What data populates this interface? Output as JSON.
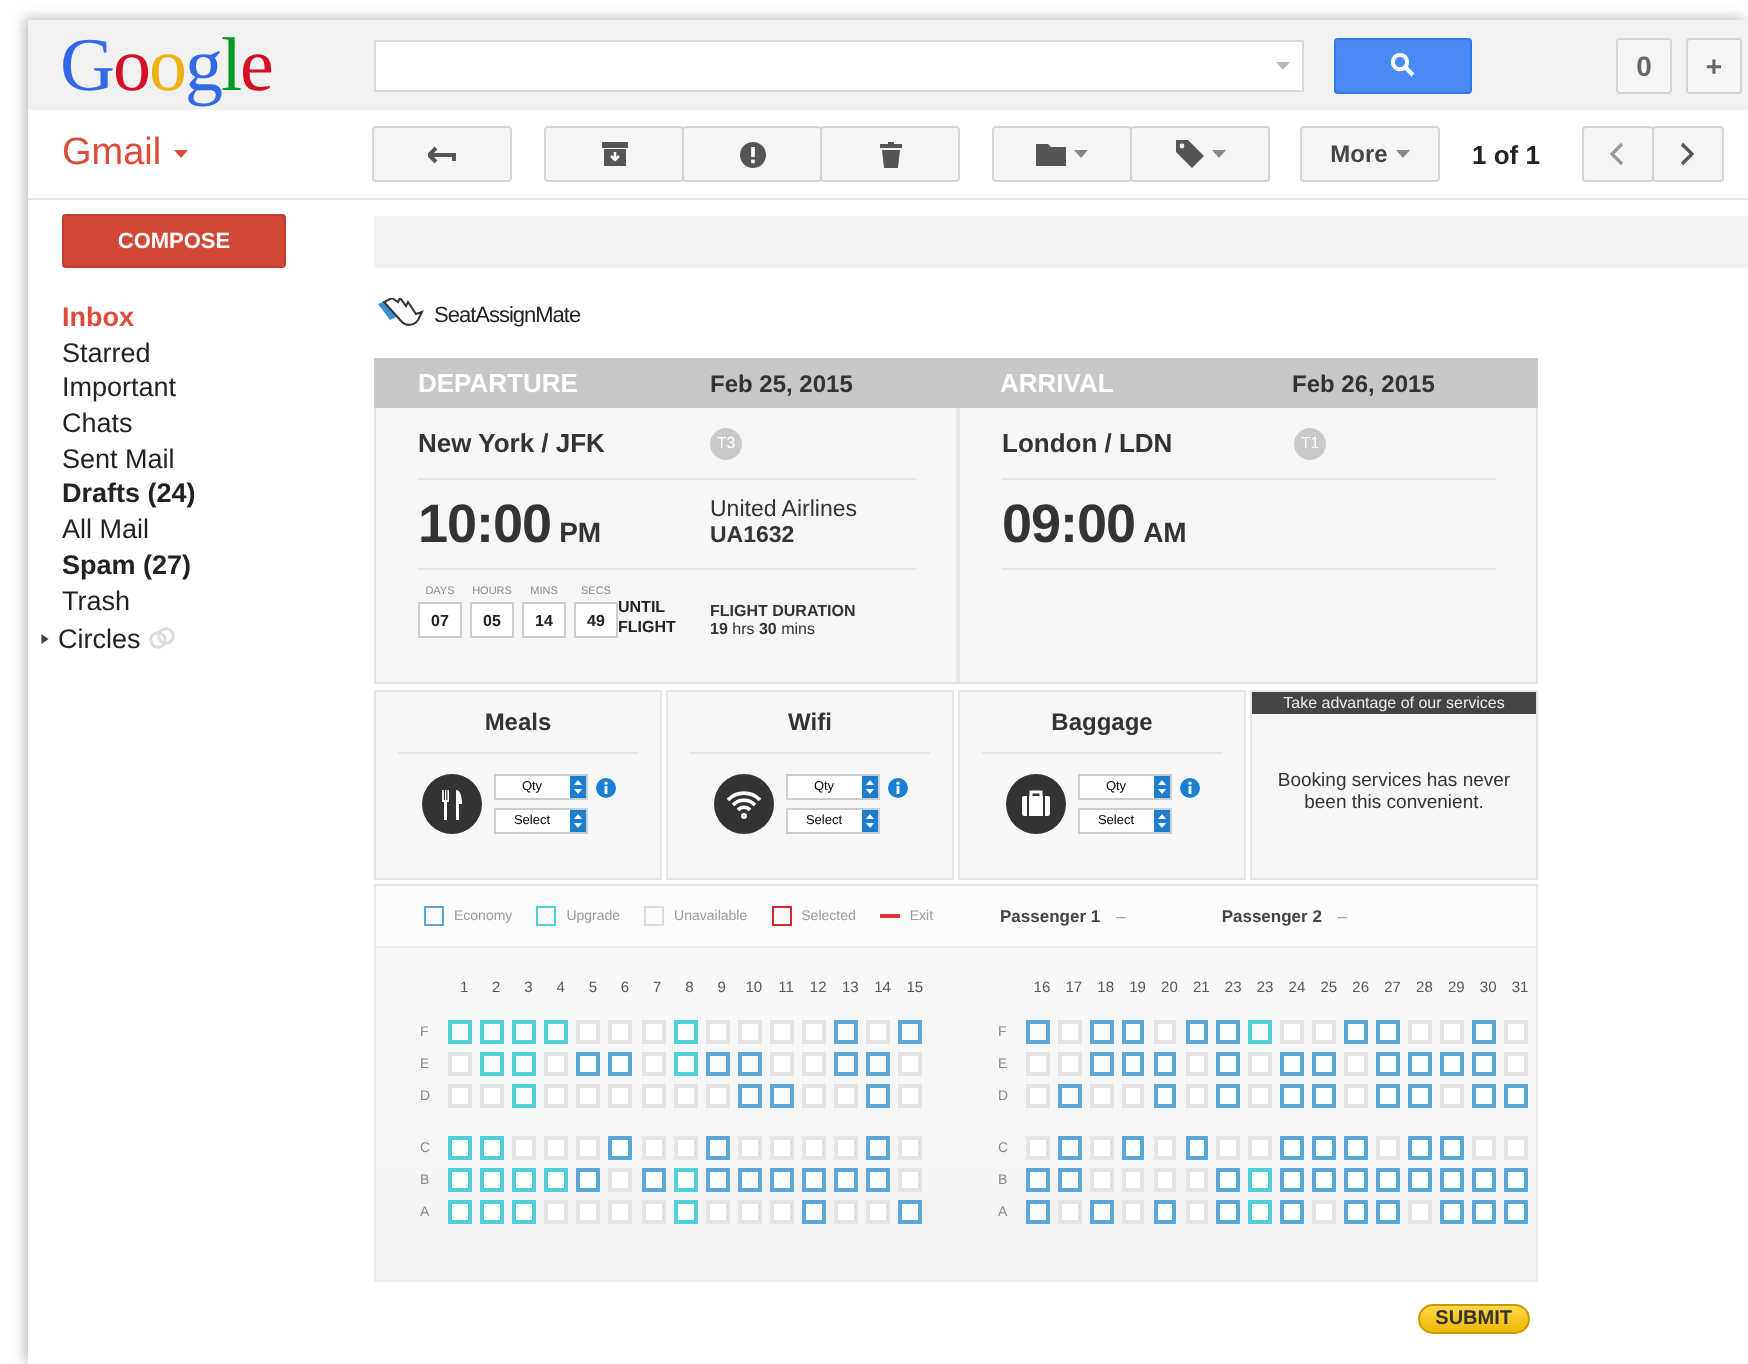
{
  "header": {
    "logo": "Google",
    "counter_button": "0",
    "add_button": "+"
  },
  "toolbar": {
    "app_label": "Gmail",
    "more": "More",
    "pagination": "1 of 1"
  },
  "sidebar": {
    "compose": "COMPOSE",
    "items": [
      {
        "label": "Inbox",
        "selected": true,
        "bold": true
      },
      {
        "label": "Starred",
        "selected": false,
        "bold": false
      },
      {
        "label": "Important",
        "selected": false,
        "bold": false
      },
      {
        "label": "Chats",
        "selected": false,
        "bold": false
      },
      {
        "label": "Sent Mail",
        "selected": false,
        "bold": false
      },
      {
        "label": "Drafts (24)",
        "selected": false,
        "bold": true
      },
      {
        "label": "All Mail",
        "selected": false,
        "bold": false
      },
      {
        "label": "Spam (27)",
        "selected": false,
        "bold": true
      },
      {
        "label": "Trash",
        "selected": false,
        "bold": false
      }
    ],
    "circles": {
      "label": "Circles",
      "expanded": false
    }
  },
  "email": {
    "brand": "SeatAssignMate",
    "flight": {
      "departure": {
        "heading": "DEPARTURE",
        "date": "Feb 25, 2015",
        "city": "New York / JFK",
        "terminal": "T3",
        "time": "10:00",
        "meridiem": "PM",
        "airline": "United Airlines",
        "flight_number": "UA1632",
        "countdown": [
          {
            "unit": "DAYS",
            "value": "07"
          },
          {
            "unit": "HOURS",
            "value": "05"
          },
          {
            "unit": "MINS",
            "value": "14"
          },
          {
            "unit": "SECS",
            "value": "49"
          }
        ],
        "countdown_label": "UNTIL FLIGHT",
        "duration_label": "FLIGHT DURATION",
        "duration": "**19** hrs  **30** mins"
      },
      "arrival": {
        "heading": "ARRIVAL",
        "date": "Feb 26, 2015",
        "city": "London / LDN",
        "terminal": "T1",
        "time": "09:00",
        "meridiem": "AM"
      }
    },
    "services": [
      {
        "kind": "meals",
        "title": "Meals",
        "qty": "Qty",
        "select": "Select"
      },
      {
        "kind": "wifi",
        "title": "Wifi",
        "qty": "Qty",
        "select": "Select"
      },
      {
        "kind": "baggage",
        "title": "Baggage",
        "qty": "Qty",
        "select": "Select"
      }
    ],
    "promo": {
      "heading": "Take advantage of our services",
      "text": "Booking services has never been this convenient."
    },
    "legend": [
      {
        "kind": "economy",
        "label": "Economy"
      },
      {
        "kind": "upgrade",
        "label": "Upgrade"
      },
      {
        "kind": "unavailable",
        "label": "Unavailable"
      },
      {
        "kind": "selected",
        "label": "Selected"
      },
      {
        "kind": "exit",
        "label": "Exit"
      }
    ],
    "passengers": [
      {
        "label": "Passenger 1",
        "seat": "–"
      },
      {
        "label": "Passenger 2",
        "seat": "–"
      }
    ],
    "seat_map": {
      "sections": [
        {
          "columns": [
            "1",
            "2",
            "3",
            "4",
            "5",
            "6",
            "7",
            "8",
            "9",
            "10",
            "11",
            "12",
            "13",
            "14",
            "15"
          ],
          "rows": [
            {
              "letter": "F",
              "seats": [
                {
                  "kind": "upgrade"
                },
                {
                  "kind": "upgrade"
                },
                {
                  "kind": "upgrade"
                },
                {
                  "kind": "upgrade"
                },
                {
                  "kind": "unavailable"
                },
                {
                  "kind": "unavailable"
                },
                {
                  "kind": "unavailable"
                },
                {
                  "kind": "upgrade"
                },
                {
                  "kind": "unavailable"
                },
                {
                  "kind": "unavailable"
                },
                {
                  "kind": "unavailable"
                },
                {
                  "kind": "unavailable"
                },
                {
                  "kind": "economy"
                },
                {
                  "kind": "unavailable"
                },
                {
                  "kind": "economy"
                }
              ]
            },
            {
              "letter": "E",
              "seats": [
                {
                  "kind": "unavailable"
                },
                {
                  "kind": "upgrade"
                },
                {
                  "kind": "upgrade"
                },
                {
                  "kind": "unavailable"
                },
                {
                  "kind": "economy"
                },
                {
                  "kind": "economy"
                },
                {
                  "kind": "unavailable"
                },
                {
                  "kind": "upgrade"
                },
                {
                  "kind": "economy"
                },
                {
                  "kind": "economy"
                },
                {
                  "kind": "unavailable"
                },
                {
                  "kind": "unavailable"
                },
                {
                  "kind": "economy"
                },
                {
                  "kind": "economy"
                },
                {
                  "kind": "unavailable"
                }
              ]
            },
            {
              "letter": "D",
              "seats": [
                {
                  "kind": "unavailable"
                },
                {
                  "kind": "unavailable"
                },
                {
                  "kind": "upgrade"
                },
                {
                  "kind": "unavailable"
                },
                {
                  "kind": "unavailable"
                },
                {
                  "kind": "unavailable"
                },
                {
                  "kind": "unavailable"
                },
                {
                  "kind": "unavailable"
                },
                {
                  "kind": "unavailable"
                },
                {
                  "kind": "economy"
                },
                {
                  "kind": "economy"
                },
                {
                  "kind": "unavailable"
                },
                {
                  "kind": "unavailable"
                },
                {
                  "kind": "economy"
                },
                {
                  "kind": "unavailable"
                }
              ]
            },
            {
              "letter": "C",
              "seats": [
                {
                  "kind": "upgrade"
                },
                {
                  "kind": "upgrade"
                },
                {
                  "kind": "unavailable"
                },
                {
                  "kind": "unavailable"
                },
                {
                  "kind": "unavailable"
                },
                {
                  "kind": "economy"
                },
                {
                  "kind": "unavailable"
                },
                {
                  "kind": "unavailable"
                },
                {
                  "kind": "economy"
                },
                {
                  "kind": "unavailable"
                },
                {
                  "kind": "unavailable"
                },
                {
                  "kind": "unavailable"
                },
                {
                  "kind": "unavailable"
                },
                {
                  "kind": "economy"
                },
                {
                  "kind": "unavailable"
                }
              ]
            },
            {
              "letter": "B",
              "seats": [
                {
                  "kind": "upgrade"
                },
                {
                  "kind": "upgrade"
                },
                {
                  "kind": "upgrade"
                },
                {
                  "kind": "upgrade"
                },
                {
                  "kind": "economy"
                },
                {
                  "kind": "unavailable"
                },
                {
                  "kind": "economy"
                },
                {
                  "kind": "upgrade"
                },
                {
                  "kind": "economy"
                },
                {
                  "kind": "economy"
                },
                {
                  "kind": "economy"
                },
                {
                  "kind": "economy"
                },
                {
                  "kind": "economy"
                },
                {
                  "kind": "economy"
                },
                {
                  "kind": "unavailable"
                }
              ]
            },
            {
              "letter": "A",
              "seats": [
                {
                  "kind": "upgrade"
                },
                {
                  "kind": "upgrade"
                },
                {
                  "kind": "upgrade"
                },
                {
                  "kind": "unavailable"
                },
                {
                  "kind": "unavailable"
                },
                {
                  "kind": "unavailable"
                },
                {
                  "kind": "unavailable"
                },
                {
                  "kind": "upgrade"
                },
                {
                  "kind": "unavailable"
                },
                {
                  "kind": "unavailable"
                },
                {
                  "kind": "unavailable"
                },
                {
                  "kind": "economy"
                },
                {
                  "kind": "unavailable"
                },
                {
                  "kind": "unavailable"
                },
                {
                  "kind": "economy"
                }
              ]
            }
          ]
        },
        {
          "columns": [
            "16",
            "17",
            "18",
            "19",
            "20",
            "21",
            "23",
            "23",
            "24",
            "25",
            "26",
            "27",
            "28",
            "29",
            "30",
            "31"
          ],
          "rows": [
            {
              "letter": "F",
              "seats": [
                {
                  "kind": "economy"
                },
                {
                  "kind": "unavailable"
                },
                {
                  "kind": "economy"
                },
                {
                  "kind": "economy"
                },
                {
                  "kind": "unavailable"
                },
                {
                  "kind": "economy"
                },
                {
                  "kind": "economy"
                },
                {
                  "kind": "upgrade"
                },
                {
                  "kind": "unavailable"
                },
                {
                  "kind": "unavailable"
                },
                {
                  "kind": "economy"
                },
                {
                  "kind": "economy"
                },
                {
                  "kind": "unavailable"
                },
                {
                  "kind": "unavailable"
                },
                {
                  "kind": "economy"
                },
                {
                  "kind": "unavailable"
                }
              ]
            },
            {
              "letter": "E",
              "seats": [
                {
                  "kind": "unavailable"
                },
                {
                  "kind": "unavailable"
                },
                {
                  "kind": "economy"
                },
                {
                  "kind": "economy"
                },
                {
                  "kind": "economy"
                },
                {
                  "kind": "unavailable"
                },
                {
                  "kind": "economy"
                },
                {
                  "kind": "unavailable"
                },
                {
                  "kind": "economy"
                },
                {
                  "kind": "economy"
                },
                {
                  "kind": "unavailable"
                },
                {
                  "kind": "economy"
                },
                {
                  "kind": "economy"
                },
                {
                  "kind": "economy"
                },
                {
                  "kind": "economy"
                },
                {
                  "kind": "unavailable"
                }
              ]
            },
            {
              "letter": "D",
              "seats": [
                {
                  "kind": "unavailable"
                },
                {
                  "kind": "economy"
                },
                {
                  "kind": "unavailable"
                },
                {
                  "kind": "unavailable"
                },
                {
                  "kind": "economy"
                },
                {
                  "kind": "unavailable"
                },
                {
                  "kind": "economy"
                },
                {
                  "kind": "unavailable"
                },
                {
                  "kind": "economy"
                },
                {
                  "kind": "economy"
                },
                {
                  "kind": "unavailable"
                },
                {
                  "kind": "economy"
                },
                {
                  "kind": "economy"
                },
                {
                  "kind": "unavailable"
                },
                {
                  "kind": "economy"
                },
                {
                  "kind": "economy"
                }
              ]
            },
            {
              "letter": "C",
              "seats": [
                {
                  "kind": "unavailable"
                },
                {
                  "kind": "economy"
                },
                {
                  "kind": "unavailable"
                },
                {
                  "kind": "economy"
                },
                {
                  "kind": "unavailable"
                },
                {
                  "kind": "economy"
                },
                {
                  "kind": "unavailable"
                },
                {
                  "kind": "unavailable"
                },
                {
                  "kind": "economy"
                },
                {
                  "kind": "economy"
                },
                {
                  "kind": "economy"
                },
                {
                  "kind": "unavailable"
                },
                {
                  "kind": "economy"
                },
                {
                  "kind": "economy"
                },
                {
                  "kind": "unavailable"
                },
                {
                  "kind": "unavailable"
                }
              ]
            },
            {
              "letter": "B",
              "seats": [
                {
                  "kind": "economy"
                },
                {
                  "kind": "economy"
                },
                {
                  "kind": "unavailable"
                },
                {
                  "kind": "unavailable"
                },
                {
                  "kind": "unavailable"
                },
                {
                  "kind": "unavailable"
                },
                {
                  "kind": "economy"
                },
                {
                  "kind": "upgrade"
                },
                {
                  "kind": "economy"
                },
                {
                  "kind": "economy"
                },
                {
                  "kind": "economy"
                },
                {
                  "kind": "economy"
                },
                {
                  "kind": "economy"
                },
                {
                  "kind": "economy"
                },
                {
                  "kind": "economy"
                },
                {
                  "kind": "economy"
                }
              ]
            },
            {
              "letter": "A",
              "seats": [
                {
                  "kind": "economy"
                },
                {
                  "kind": "unavailable"
                },
                {
                  "kind": "economy"
                },
                {
                  "kind": "unavailable"
                },
                {
                  "kind": "economy"
                },
                {
                  "kind": "unavailable"
                },
                {
                  "kind": "economy"
                },
                {
                  "kind": "upgrade"
                },
                {
                  "kind": "economy"
                },
                {
                  "kind": "unavailable"
                },
                {
                  "kind": "economy"
                },
                {
                  "kind": "economy"
                },
                {
                  "kind": "unavailable"
                },
                {
                  "kind": "economy"
                },
                {
                  "kind": "economy"
                },
                {
                  "kind": "economy"
                }
              ]
            }
          ]
        }
      ]
    },
    "submit": "SUBMIT"
  }
}
